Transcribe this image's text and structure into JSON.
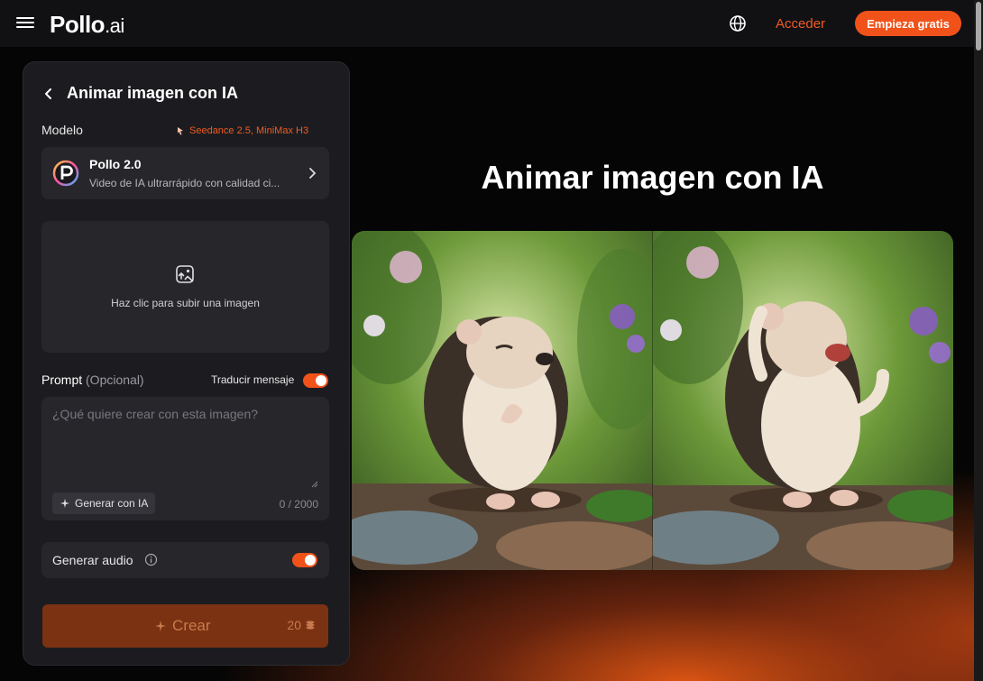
{
  "header": {
    "logo_main": "Pollo",
    "logo_suffix": ".ai",
    "login_label": "Acceder",
    "start_label": "Empieza gratis"
  },
  "panel": {
    "title": "Animar imagen con IA",
    "model_label": "Modelo",
    "model_tag": "Seedance 2.5, MiniMax H3",
    "model": {
      "name": "Pollo 2.0",
      "description": "Video de IA ultrarrápido con calidad ci..."
    },
    "upload_text": "Haz clic para subir una imagen",
    "prompt_label": "Prompt",
    "prompt_optional": "(Opcional)",
    "translate_label": "Traducir mensaje",
    "prompt_placeholder": "¿Qué quiere crear con esta imagen?",
    "prompt_value": "",
    "generate_ai_label": "Generar con IA",
    "char_counter": "0 / 2000",
    "audio_label": "Generar audio",
    "create_label": "Crear",
    "credits": "20"
  },
  "main": {
    "title": "Animar imagen con IA"
  },
  "toggles": {
    "translate_on": true,
    "audio_on": true
  },
  "colors": {
    "accent": "#f0521a",
    "panel_bg": "#1c1c20",
    "card_bg": "#26262b",
    "create_disabled": "#7a3212"
  },
  "icons": [
    "menu-icon",
    "globe-icon",
    "back-icon",
    "pointer-icon",
    "pollo-logo-icon",
    "chevron-right-icon",
    "image-upload-icon",
    "sparkle-icon",
    "info-icon",
    "coin-stack-icon"
  ]
}
